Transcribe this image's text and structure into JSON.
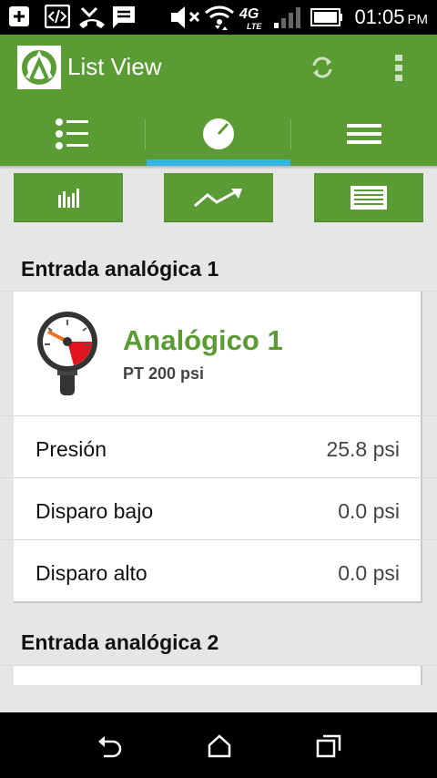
{
  "status_bar": {
    "time": "01:05",
    "ampm": "PM",
    "network": "4G",
    "network_sub": "LTE",
    "icons": [
      "add-box-icon",
      "code-icon",
      "missed-call-icon",
      "message-icon",
      "mute-icon",
      "wifi-icon",
      "signal-icon",
      "battery-icon"
    ]
  },
  "app_bar": {
    "title": "List View",
    "actions": [
      "refresh-icon",
      "overflow-menu-icon"
    ]
  },
  "tabs": [
    {
      "icon": "list-icon",
      "selected": false
    },
    {
      "icon": "gauge-icon",
      "selected": true
    },
    {
      "icon": "menu-lines-icon",
      "selected": false
    }
  ],
  "view_buttons": [
    {
      "icon": "bar-chart-icon"
    },
    {
      "icon": "trend-line-icon"
    },
    {
      "icon": "table-icon"
    }
  ],
  "sections": [
    {
      "title": "Entrada analógica 1",
      "device": {
        "name": "Analógico 1",
        "subtitle": "PT 200 psi",
        "icon": "pressure-gauge-icon"
      },
      "rows": [
        {
          "label": "Presión",
          "value": "25.8 psi"
        },
        {
          "label": "Disparo bajo",
          "value": "0.0 psi"
        },
        {
          "label": "Disparo alto",
          "value": "0.0 psi"
        }
      ]
    },
    {
      "title": "Entrada analógica 2"
    }
  ],
  "nav_bar": [
    "back-icon",
    "home-icon",
    "recent-apps-icon"
  ],
  "colors": {
    "primary": "#5a9b33",
    "accent": "#33b5e5",
    "gauge_red": "#e0141e"
  }
}
